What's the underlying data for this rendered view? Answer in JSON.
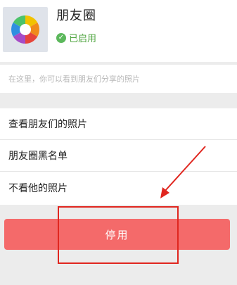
{
  "header": {
    "title": "朋友圈",
    "status": "已启用",
    "status_icon": "check-circle-icon",
    "app_icon": "aperture-icon",
    "status_color": "#4aa23a"
  },
  "description": "在这里，你可以看到朋友们分享的照片",
  "menu": {
    "items": [
      {
        "label": "查看朋友们的照片"
      },
      {
        "label": "朋友圈黑名单"
      },
      {
        "label": "不看他的照片"
      }
    ]
  },
  "action": {
    "label": "停用",
    "color": "#f46a6a"
  },
  "annotation": {
    "color": "#e0261f"
  }
}
